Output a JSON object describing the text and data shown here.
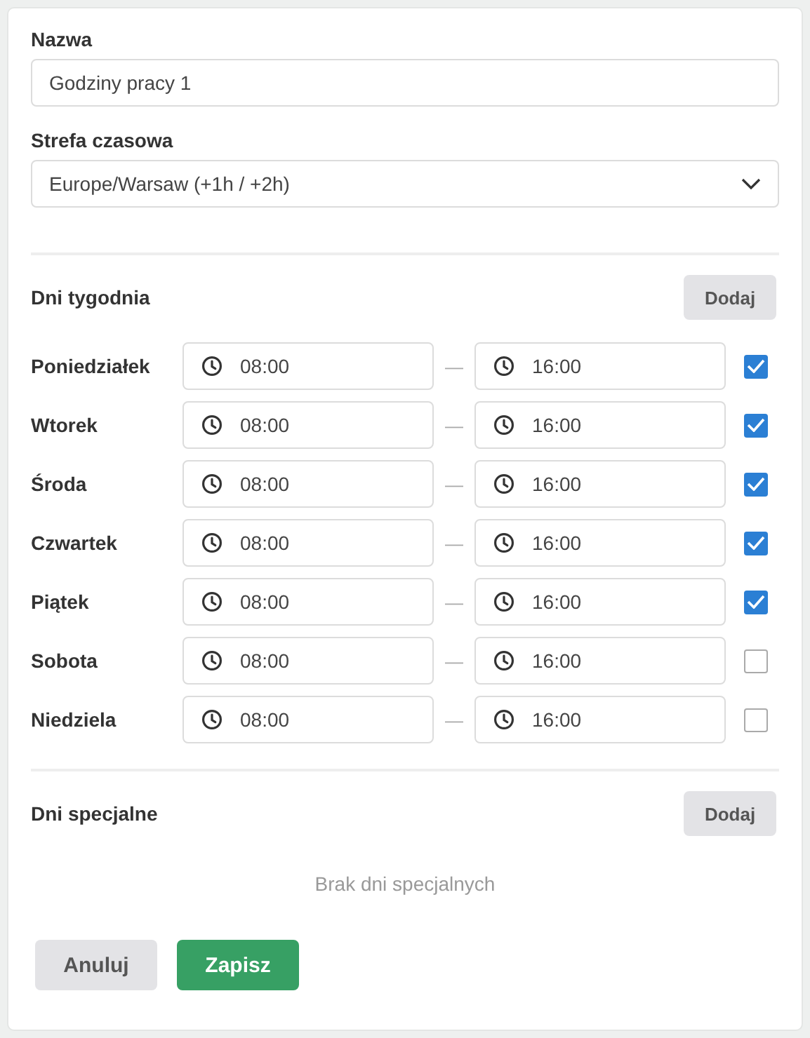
{
  "name_field": {
    "label": "Nazwa",
    "value": "Godziny pracy 1"
  },
  "timezone_field": {
    "label": "Strefa czasowa",
    "value": "Europe/Warsaw (+1h / +2h)"
  },
  "weekdays": {
    "title": "Dni tygodnia",
    "add_button": "Dodaj",
    "days": [
      {
        "label": "Poniedziałek",
        "start": "08:00",
        "separator": "—",
        "end": "16:00",
        "checked": true
      },
      {
        "label": "Wtorek",
        "start": "08:00",
        "separator": "—",
        "end": "16:00",
        "checked": true
      },
      {
        "label": "Środa",
        "start": "08:00",
        "separator": "—",
        "end": "16:00",
        "checked": true
      },
      {
        "label": "Czwartek",
        "start": "08:00",
        "separator": "—",
        "end": "16:00",
        "checked": true
      },
      {
        "label": "Piątek",
        "start": "08:00",
        "separator": "—",
        "end": "16:00",
        "checked": true
      },
      {
        "label": "Sobota",
        "start": "08:00",
        "separator": "—",
        "end": "16:00",
        "checked": false
      },
      {
        "label": "Niedziela",
        "start": "08:00",
        "separator": "—",
        "end": "16:00",
        "checked": false
      }
    ]
  },
  "special_days": {
    "title": "Dni specjalne",
    "add_button": "Dodaj",
    "empty_text": "Brak dni specjalnych"
  },
  "buttons": [
    {
      "label": "Anuluj",
      "kind": "secondary"
    },
    {
      "label": "Zapisz",
      "kind": "primary"
    }
  ]
}
